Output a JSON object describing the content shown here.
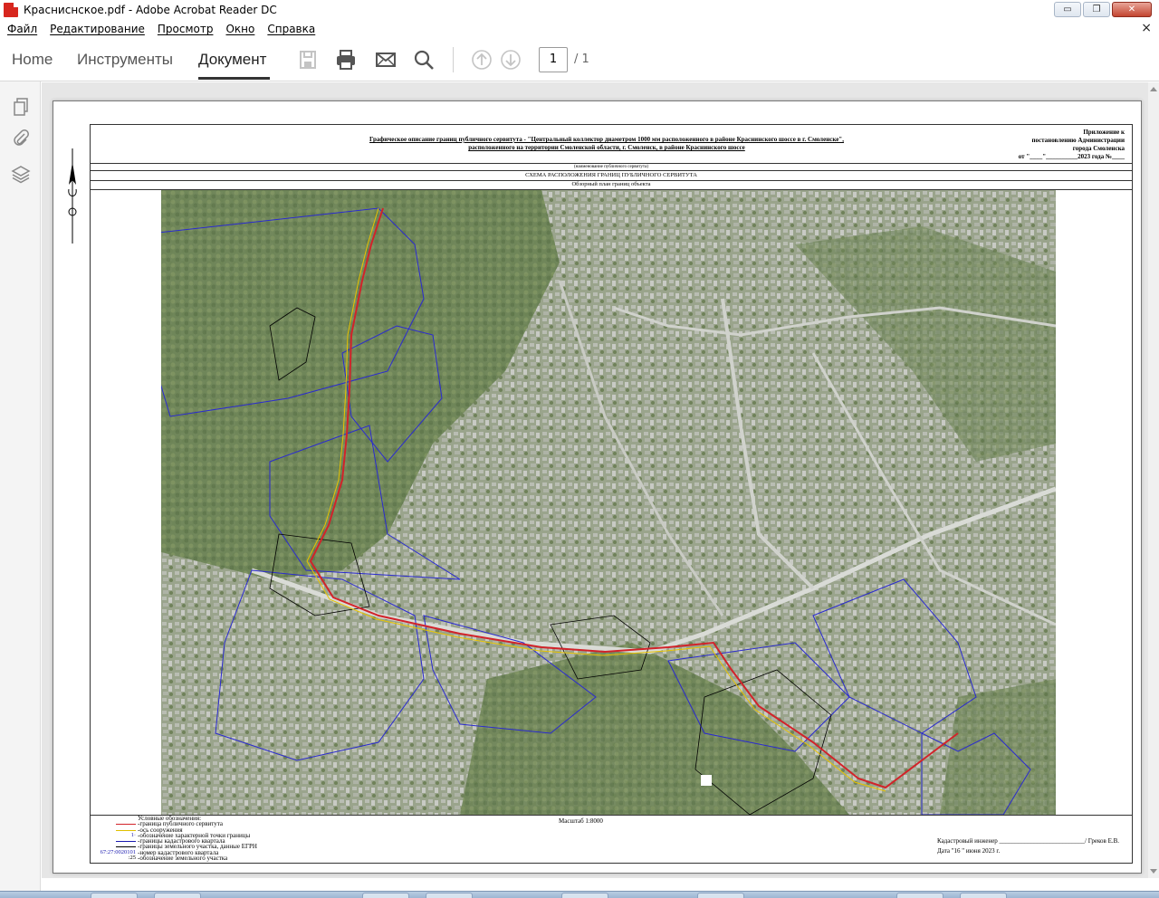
{
  "window": {
    "title": "Красниснское.pdf - Adobe Acrobat Reader DC",
    "minimize": "▭",
    "maximize": "❐",
    "close": "✕"
  },
  "menu": {
    "items": [
      "Файл",
      "Редактирование",
      "Просмотр",
      "Окно",
      "Справка"
    ],
    "close_doc": "×"
  },
  "toolbar": {
    "tabs": [
      "Home",
      "Инструменты",
      "Документ"
    ],
    "active_tab": "Документ",
    "icons": [
      "save-icon",
      "print-icon",
      "email-icon",
      "search-icon",
      "page-up-icon",
      "page-down-icon"
    ],
    "page_current": "1",
    "page_total": "/ 1"
  },
  "left_rail": {
    "icons": [
      "pages-icon",
      "attachment-icon",
      "layers-icon"
    ]
  },
  "document": {
    "title_line1": "Графическое описание границ публичного сервитута - \"Центральный коллектор диаметром 1000 мм расположенного в районе Краснинского шоссе в г. Смоленске\",",
    "title_line2": "расположенного на территории Смоленской области, г. Смоленск, в районе Краснинского шоссе",
    "appendix_line1": "Приложение к",
    "appendix_line2": "постановлению Администрации",
    "appendix_line3": "города Смоленска",
    "appendix_line4": "от \"____\"__________2023 года №____",
    "caption_name": "(наименование публичного сервитута)",
    "caption_scheme": "СХЕМА РАСПОЛОЖЕНИЯ ГРАНИЦ ПУБЛИЧНОГО СЕРВИТУТА",
    "caption_overview": "Обзорный план границ объекта",
    "legend_title": "Условные обозначения:",
    "legend": [
      {
        "code": "",
        "text": "-граница публичного сервитута",
        "color": "#d2232a"
      },
      {
        "code": "",
        "text": "-ось сооружения",
        "color": "#e0c000"
      },
      {
        "code": "1·",
        "text": "-обозначение характерной точки границы",
        "color": ""
      },
      {
        "code": "",
        "text": "-границы кадастрового квартала",
        "color": "#1a1ab0"
      },
      {
        "code": "",
        "text": "-границы земельного участка, данные ЕГРН",
        "color": "#000000"
      },
      {
        "code": "67:27:0020101",
        "text": "-номер кадастрового квартала",
        "color": ""
      },
      {
        "code": ":25",
        "text": "-обозначение земельного участка",
        "color": ""
      }
    ],
    "scale": "Масштаб 1:8000",
    "engineer": "Кадастровый инженер ___________________________/ Греков Е.В.",
    "date": "Дата \"16 \"  июня  2023 г."
  }
}
